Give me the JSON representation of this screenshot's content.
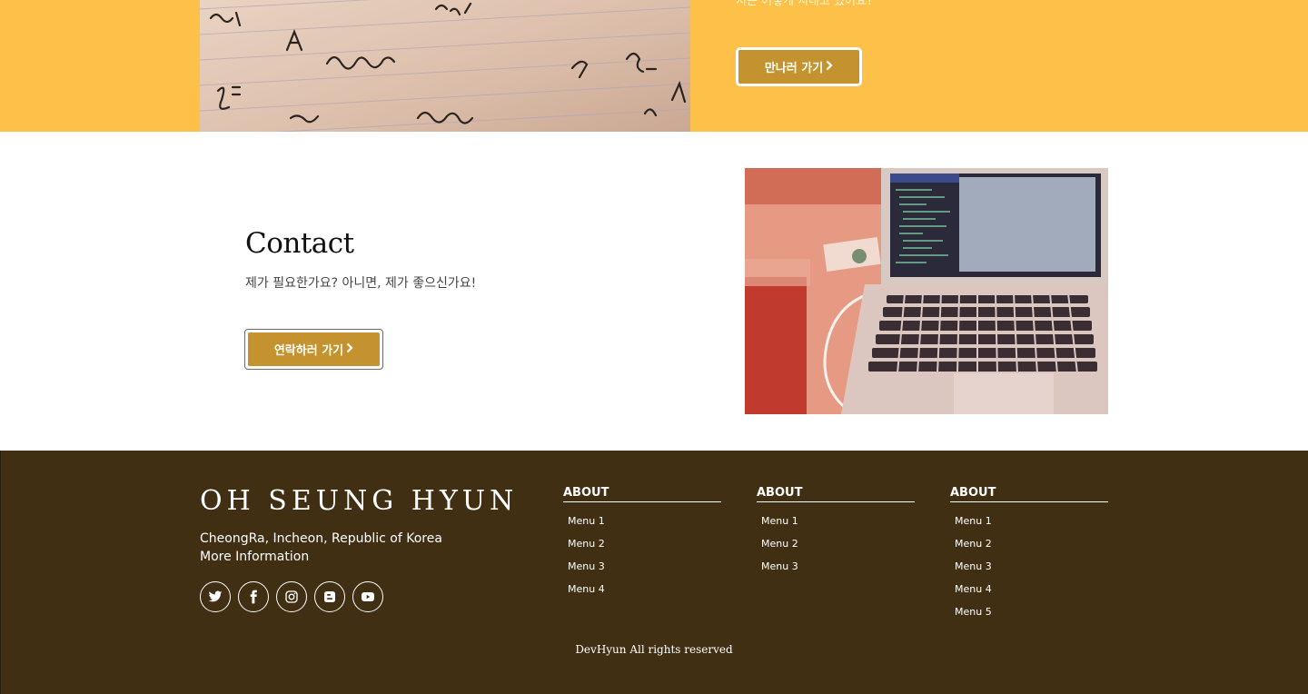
{
  "about_band": {
    "text_partial": "지는 어떻게 지내고 있어요?",
    "button_label": "만나러 가기",
    "button_chevron": "›"
  },
  "contact": {
    "title": "Contact",
    "subtitle": "제가 필요한가요? 아니면, 제가 좋으신가요!",
    "button_label": "연락하러 가기",
    "button_chevron": "›"
  },
  "footer": {
    "brand": "OH SEUNG HYUN",
    "address_line1": "CheongRa, Incheon, Republic of Korea",
    "address_line2": "More Information",
    "social": [
      "twitter-icon",
      "facebook-icon",
      "instagram-icon",
      "blogger-icon",
      "youtube-icon"
    ],
    "columns": [
      {
        "heading": "ABOUT",
        "items": [
          "Menu 1",
          "Menu 2",
          "Menu 3",
          "Menu 4"
        ]
      },
      {
        "heading": "ABOUT",
        "items": [
          "Menu 1",
          "Menu 2",
          "Menu 3"
        ]
      },
      {
        "heading": "ABOUT",
        "items": [
          "Menu 1",
          "Menu 2",
          "Menu 3",
          "Menu 4",
          "Menu 5"
        ]
      }
    ],
    "copyright": "DevHyun All rights reserved"
  },
  "colors": {
    "band_yellow": "#fdc149",
    "button_gold": "#c4922e",
    "footer_brown": "#412f13"
  }
}
